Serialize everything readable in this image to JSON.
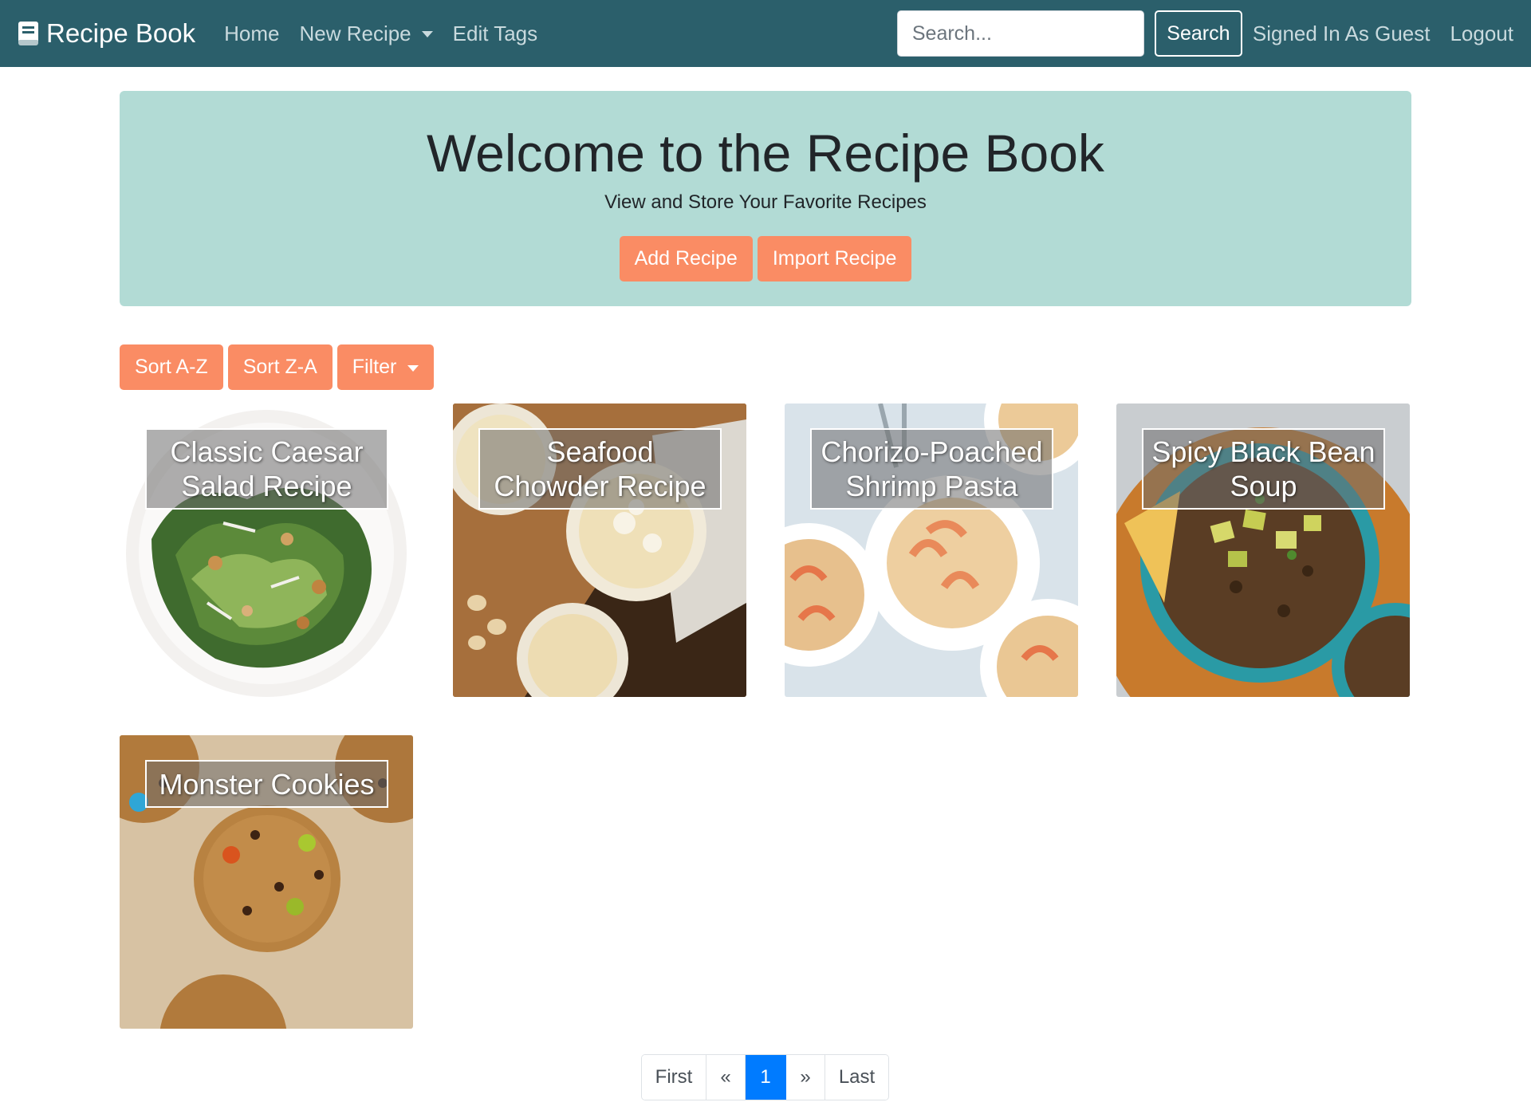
{
  "navbar": {
    "brand": "Recipe Book",
    "brand_icon": "book-icon",
    "links": {
      "home": "Home",
      "new_recipe": "New Recipe",
      "edit_tags": "Edit Tags"
    },
    "search": {
      "placeholder": "Search...",
      "button": "Search"
    },
    "user_status": "Signed In As Guest",
    "logout": "Logout",
    "color": "#2b5f6b"
  },
  "hero": {
    "title": "Welcome to the Recipe Book",
    "subtitle": "View and Store Your Favorite Recipes",
    "add_button": "Add Recipe",
    "import_button": "Import Recipe",
    "background": "#b2dbd5"
  },
  "controls": {
    "sort_az": "Sort A-Z",
    "sort_za": "Sort Z-A",
    "filter": "Filter",
    "accent": "#fa8c64"
  },
  "recipes": [
    {
      "title": "Classic Caesar Salad Recipe",
      "image": "caesar-salad-photo"
    },
    {
      "title": "Seafood Chowder Recipe",
      "image": "seafood-chowder-photo"
    },
    {
      "title": "Chorizo-Poached Shrimp Pasta",
      "image": "shrimp-pasta-photo"
    },
    {
      "title": "Spicy Black Bean Soup",
      "image": "black-bean-soup-photo"
    },
    {
      "title": "Monster Cookies",
      "image": "monster-cookies-photo"
    }
  ],
  "pagination": {
    "first": "First",
    "prev": "«",
    "current": "1",
    "next": "»",
    "last": "Last",
    "active_color": "#007bff"
  }
}
